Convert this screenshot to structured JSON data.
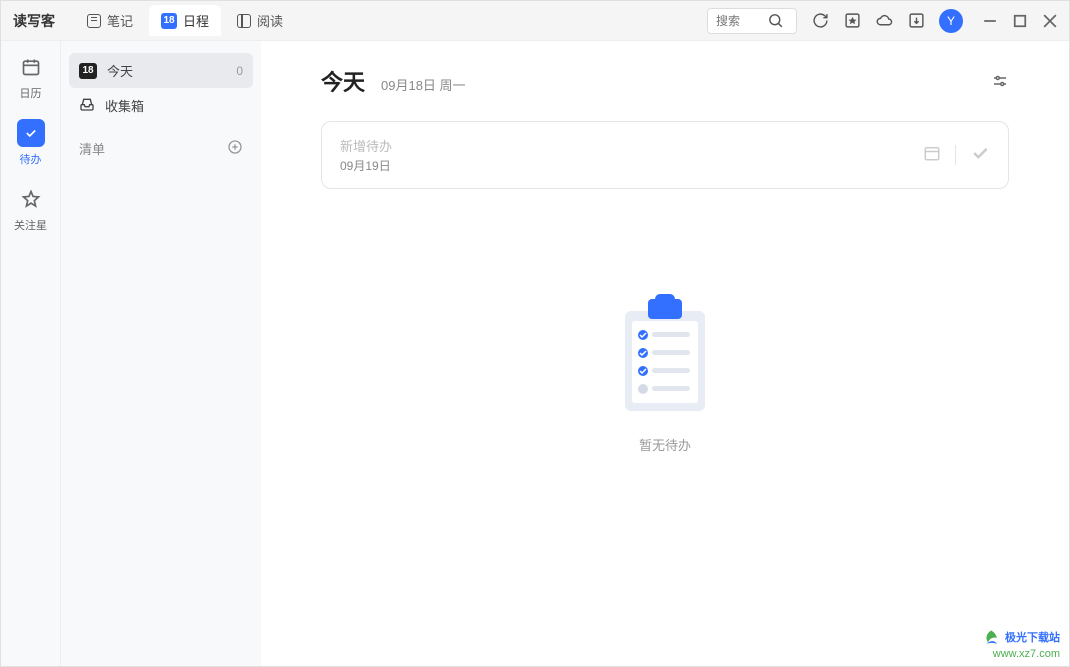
{
  "app": {
    "name": "读写客"
  },
  "tabs": {
    "notes": {
      "label": "笔记"
    },
    "schedule": {
      "label": "日程",
      "badge": "18"
    },
    "read": {
      "label": "阅读"
    }
  },
  "search": {
    "placeholder": "搜索"
  },
  "avatar": {
    "letter": "Y"
  },
  "rail": {
    "calendar": {
      "label": "日历"
    },
    "todo": {
      "label": "待办"
    },
    "star": {
      "label": "关注星"
    }
  },
  "sidebar": {
    "today": {
      "label": "今天",
      "badge": "18",
      "count": "0"
    },
    "inbox": {
      "label": "收集箱"
    },
    "list_section": {
      "label": "清单"
    }
  },
  "main": {
    "title": "今天",
    "date": "09月18日 周一",
    "todo": {
      "placeholder": "新增待办",
      "sub_date": "09月19日"
    },
    "empty": "暂无待办"
  },
  "watermark": {
    "line1": "极光下载站",
    "line2": "www.xz7.com"
  }
}
